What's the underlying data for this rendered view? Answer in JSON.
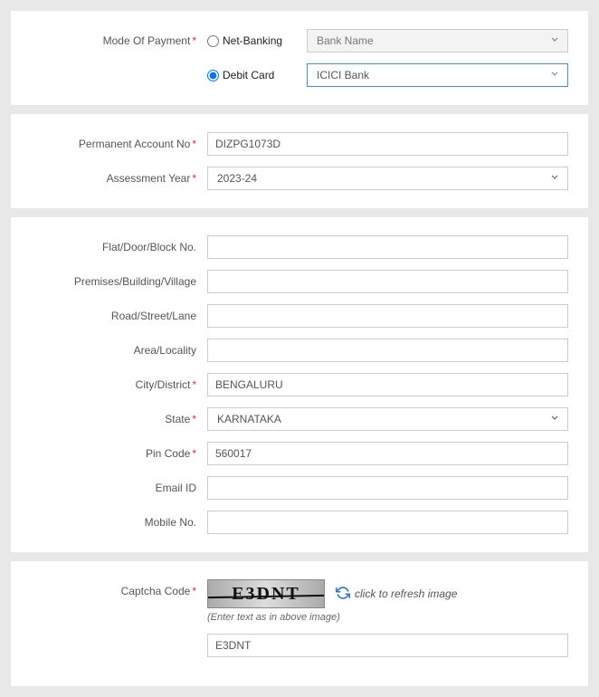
{
  "payment": {
    "label": "Mode Of Payment",
    "netbanking_label": "Net-Banking",
    "debitcard_label": "Debit Card",
    "bankname_placeholder": "Bank Name",
    "bank_selected": "ICICI Bank"
  },
  "account": {
    "pan_label": "Permanent Account No",
    "pan_value": "DIZPG1073D",
    "ay_label": "Assessment Year",
    "ay_value": "2023-24"
  },
  "address": {
    "flat_label": "Flat/Door/Block No.",
    "flat_value": "",
    "premises_label": "Premises/Building/Village",
    "premises_value": "",
    "road_label": "Road/Street/Lane",
    "road_value": "",
    "area_label": "Area/Locality",
    "area_value": "",
    "city_label": "City/District",
    "city_value": "BENGALURU",
    "state_label": "State",
    "state_value": "KARNATAKA",
    "pin_label": "Pin Code",
    "pin_value": "560017",
    "email_label": "Email ID",
    "email_value": "",
    "mobile_label": "Mobile No.",
    "mobile_value": ""
  },
  "captcha": {
    "label": "Captcha Code",
    "image_text": "E3DNT",
    "refresh_text": "click to refresh image",
    "hint": "(Enter text as in above image)",
    "input_value": "E3DNT"
  }
}
